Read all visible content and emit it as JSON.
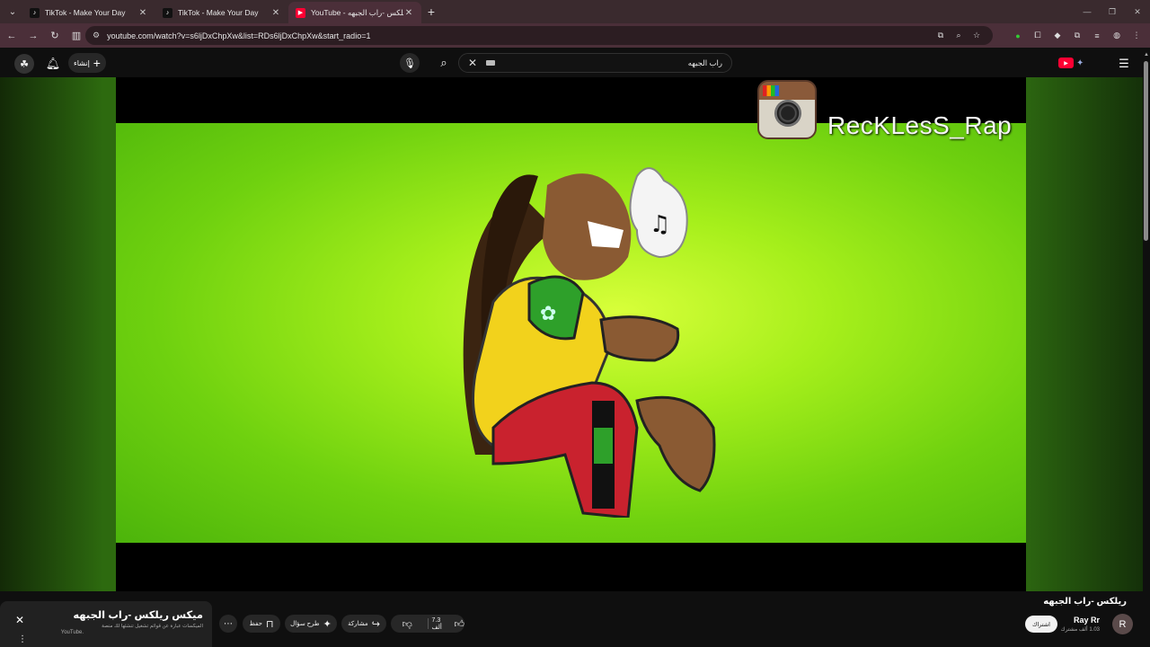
{
  "browser": {
    "tabs": [
      {
        "title": "TikTok - Make Your Day",
        "favicon": "tiktok-icon",
        "active": false
      },
      {
        "title": "TikTok - Make Your Day",
        "favicon": "tiktok-icon",
        "active": false
      },
      {
        "title": "YouTube - ريلكس -راب الجبهه",
        "favicon": "youtube-icon",
        "active": true
      }
    ],
    "url": "youtube.com/watch?v=s6ljDxChpXw&list=RDs6ljDxChpXw&start_radio=1"
  },
  "masthead": {
    "create_label": "إنشاء",
    "search_query": "راب الجبهه"
  },
  "player": {
    "watermark_handle": "RecKLesS_Rap"
  },
  "video": {
    "title": "ريلكس -راب الجبهه",
    "channel_name": "Ray Rr",
    "subscribers": "1.03 ألف مشترك",
    "subscribe_label": "اشتراك",
    "likes": "7.3 ألف",
    "share_label": "مشاركة",
    "ask_label": "طرح سؤال",
    "save_label": "حفظ"
  },
  "miniplayer": {
    "title": "ميكس ريلكس -راب الجبهه",
    "subtitle": "الميكسات عبارة عن قوائم تشغيل تنشئها لك منصة",
    "source": "YouTube."
  },
  "colors": {
    "youtube_red": "#ff0033",
    "page_bg": "#0f0f0f",
    "pill_bg": "#272727"
  }
}
